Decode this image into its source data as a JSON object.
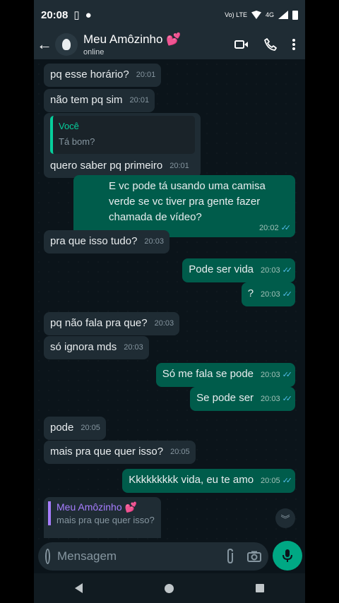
{
  "status": {
    "time": "20:08",
    "network": "Vo) LTE",
    "net4g": "4G"
  },
  "header": {
    "title": "Meu Amôzinho 💕",
    "subtitle": "online"
  },
  "messages": [
    {
      "text": "pq esse horário?",
      "time": "20:01"
    },
    {
      "text": "não tem pq sim",
      "time": "20:01"
    },
    {
      "quote_name": "Você",
      "quote_text": "Tá bom?",
      "text": "quero saber pq primeiro",
      "time": "20:01"
    },
    {
      "text": "E vc pode tá usando uma camisa verde se vc tiver pra gente fazer chamada de vídeo?",
      "time": "20:02"
    },
    {
      "text": "pra que isso tudo?",
      "time": "20:03"
    },
    {
      "text": "Pode ser vida",
      "time": "20:03"
    },
    {
      "text": "?",
      "time": "20:03"
    },
    {
      "text": "pq não fala pra que?",
      "time": "20:03"
    },
    {
      "text": "só ignora mds",
      "time": "20:03"
    },
    {
      "text": "Só me fala se pode",
      "time": "20:03"
    },
    {
      "text": "Se pode ser",
      "time": "20:03"
    },
    {
      "text": "pode",
      "time": "20:05"
    },
    {
      "text": "mais pra que quer isso?",
      "time": "20:05"
    },
    {
      "text": "Kkkkkkkkk vida, eu te amo",
      "time": "20:05"
    }
  ],
  "reply": {
    "name": "Meu Amôzinho 💕",
    "text": "mais pra que quer isso?"
  },
  "input": {
    "placeholder": "Mensagem"
  },
  "colors": {
    "incoming": "#1f2c34",
    "outgoing": "#005c4b",
    "accent": "#00a884",
    "ticks": "#53bdeb"
  }
}
